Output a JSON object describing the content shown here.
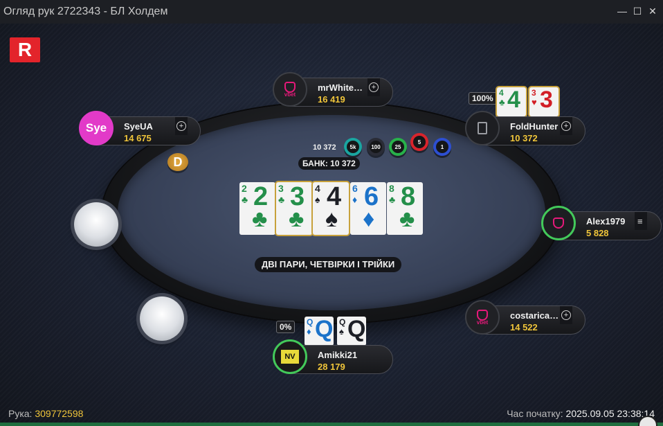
{
  "window": {
    "title": "Огляд рук 2722343 - БЛ Холдем",
    "minimize": "—",
    "maximize": "☐",
    "close": "✕"
  },
  "logo": "R",
  "players": {
    "top": {
      "name": "mrWhite…",
      "stack": "16 419",
      "avatar": "vbet"
    },
    "top_left": {
      "name": "SyeUA",
      "stack": "14 675",
      "avatar_text": "Sye",
      "avatar_color": "#e23ac8"
    },
    "top_right": {
      "name": "FoldHunter",
      "stack": "10 372",
      "equity": "100%",
      "cards": [
        {
          "rank": "4",
          "suit": "♣",
          "color": "clubs"
        },
        {
          "rank": "3",
          "suit": "♥",
          "color": "hearts"
        }
      ]
    },
    "right": {
      "name": "Alex1979",
      "stack": "5 828"
    },
    "bottom_right": {
      "name": "costarica…",
      "stack": "14 522",
      "avatar": "vbet"
    },
    "bottom": {
      "name": "Amikki21",
      "stack": "28 179",
      "equity": "0%",
      "cards": [
        {
          "rank": "Q",
          "suit": "♦",
          "color": "diamonds"
        },
        {
          "rank": "Q",
          "suit": "♠",
          "color": "spades"
        }
      ]
    }
  },
  "pot": {
    "chips_amount": "10 372",
    "chips": [
      "5k",
      "100",
      "25",
      "5",
      "1"
    ],
    "chip_colors": [
      "#1aa5a0",
      "#2a2c36",
      "#28b14a",
      "#d8242c",
      "#2d4fd1"
    ],
    "bank_label": "БАНК: 10 372"
  },
  "dealer_button": "D",
  "board": [
    {
      "rank": "2",
      "suit": "♣",
      "color": "clubs"
    },
    {
      "rank": "3",
      "suit": "♣",
      "color": "clubs"
    },
    {
      "rank": "4",
      "suit": "♠",
      "color": "spades"
    },
    {
      "rank": "6",
      "suit": "♦",
      "color": "diamonds"
    },
    {
      "rank": "8",
      "suit": "♣",
      "color": "clubs"
    }
  ],
  "hand_result": "ДВІ ПАРИ, ЧЕТВІРКИ І ТРІЙКИ",
  "footer": {
    "hand_label": "Рука:",
    "hand_number": "309772598",
    "start_label": "Час початку:",
    "start_time": "2025.09.05 23:38:14"
  },
  "replay_progress": 1.0
}
